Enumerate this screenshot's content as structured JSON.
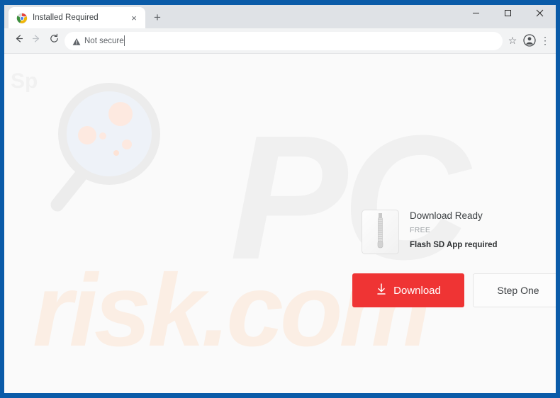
{
  "window": {
    "frame_color": "#0a5ba8",
    "controls": {
      "minimize": "–",
      "maximize": "☐",
      "close": "×"
    }
  },
  "tabstrip": {
    "tab": {
      "title": "Installed Required",
      "favicon_name": "chrome-favicon",
      "close_label": "×"
    },
    "new_tab_label": "+"
  },
  "toolbar": {
    "back_label": "←",
    "forward_label": "→",
    "reload_label": "⟳",
    "omnibox": {
      "security_text": "Not secure",
      "security_icon": "warning-triangle-icon",
      "url_value": "",
      "placeholder": ""
    },
    "bookmark_label": "☆",
    "profile_icon": "account-circle-icon",
    "menu_label": "⋮"
  },
  "page": {
    "background": "#fafafa",
    "watermarks": {
      "brand_logo": "Sp",
      "big_grey": "PC",
      "big_peach": "risk.com",
      "magnifier_icon": "magnifying-glass-icon",
      "grey_color": "#f0f0f0",
      "peach_color": "#fbeee4"
    },
    "download_panel": {
      "file_icon_name": "zip-file-icon",
      "title": "Download Ready",
      "price": "FREE",
      "requirement": "Flash SD App required"
    },
    "actions": {
      "download": {
        "label": "Download",
        "icon": "download-arrow-icon",
        "color": "#ef3434"
      },
      "step_one": {
        "label": "Step One"
      }
    }
  }
}
